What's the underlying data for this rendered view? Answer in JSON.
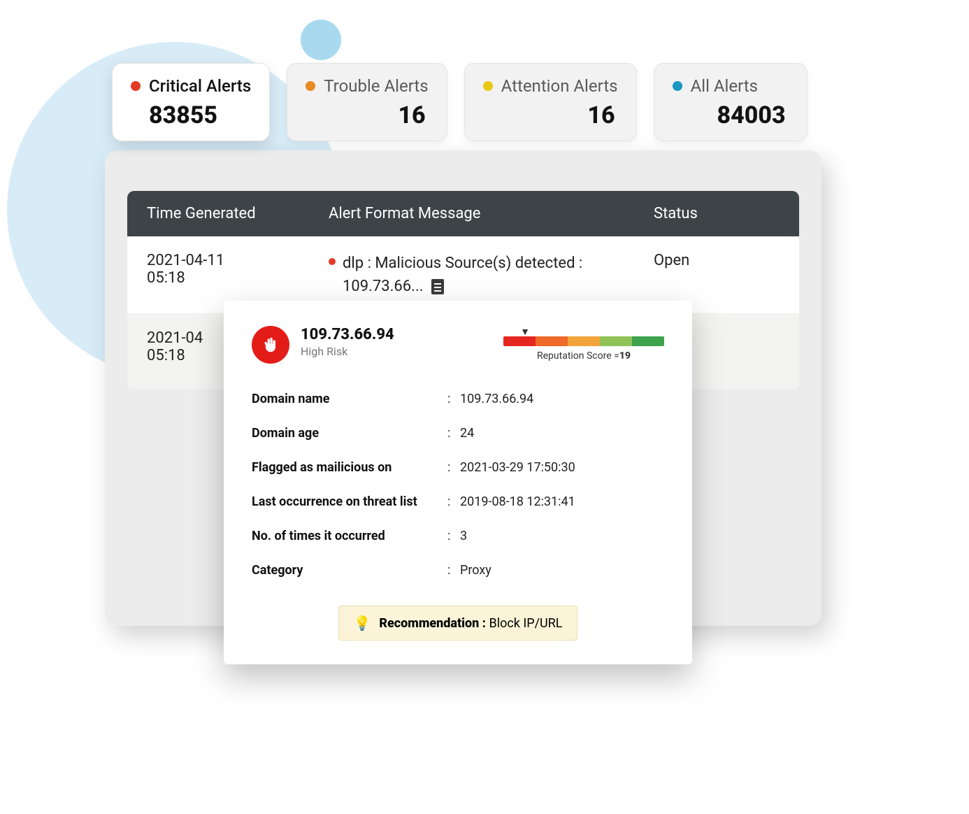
{
  "tabs": [
    {
      "label": "Critical Alerts",
      "count": "83855",
      "dot": "#e33a26",
      "active": true
    },
    {
      "label": "Trouble Alerts",
      "count": "16",
      "dot": "#e98b24",
      "active": false
    },
    {
      "label": "Attention Alerts",
      "count": "16",
      "dot": "#e9c913",
      "active": false
    },
    {
      "label": "All Alerts",
      "count": "84003",
      "dot": "#1797c2",
      "active": false
    }
  ],
  "table": {
    "headers": {
      "time": "Time Generated",
      "message": "Alert Format Message",
      "status": "Status"
    },
    "rows": [
      {
        "time": "2021-04-11\n05:18",
        "message": "dlp : Malicious Source(s) detected : 109.73.66...",
        "status": "Open"
      },
      {
        "time": "2021-04\n05:18",
        "message": "",
        "status": ""
      }
    ]
  },
  "detail": {
    "ip": "109.73.66.94",
    "risk": "High Risk",
    "rep_label_prefix": "Reputation Score =",
    "rep_score": "19",
    "rep_colors": [
      "#e52620",
      "#ef6a28",
      "#f2a33a",
      "#8fc257",
      "#3fa34d"
    ],
    "fields": [
      {
        "k": "Domain name",
        "v": "109.73.66.94"
      },
      {
        "k": "Domain age",
        "v": "24"
      },
      {
        "k": "Flagged as mailicious on",
        "v": "2021-03-29 17:50:30"
      },
      {
        "k": "Last occurrence on threat list",
        "v": "2019-08-18 12:31:41"
      },
      {
        "k": "No. of times it occurred",
        "v": "3"
      },
      {
        "k": "Category",
        "v": "Proxy"
      }
    ],
    "recommendation_label": "Recommendation :",
    "recommendation_value": "Block IP/URL"
  }
}
